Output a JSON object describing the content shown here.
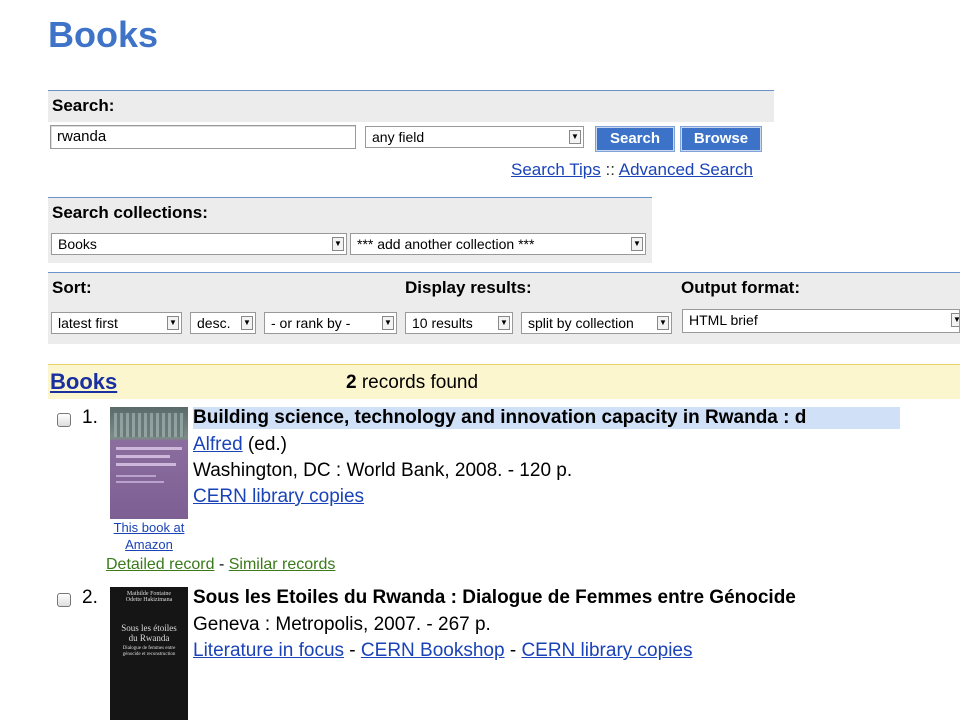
{
  "header": {
    "title": "Books"
  },
  "search": {
    "section_label": "Search:",
    "query": "rwanda",
    "field_select": "any field",
    "search_button": "Search",
    "browse_button": "Browse",
    "tips_link": "Search Tips",
    "tips_sep": "::",
    "advanced_link": "Advanced Search"
  },
  "collections": {
    "section_label": "Search collections:",
    "selected": "Books",
    "add_another": "*** add another collection ***"
  },
  "options": {
    "sort_label": "Sort:",
    "display_label": "Display results:",
    "output_label": "Output format:",
    "sort_by": "latest first",
    "order": "desc.",
    "rank_by": "- or rank by -",
    "per_page": "10 results",
    "split": "split by collection",
    "output_format": "HTML brief"
  },
  "results": {
    "collection": "Books",
    "count": "2",
    "found_text": "records found",
    "records": [
      {
        "number": "1.",
        "title": "Building science, technology and innovation capacity in Rwanda : d",
        "author_link": "Alfred",
        "author_suffix": " (ed.)",
        "publication": "Washington, DC : World Bank, 2008. - 120 p.",
        "links": [
          "CERN library copies"
        ],
        "amazon_link": "This book at Amazon",
        "detailed_link": "Detailed record",
        "similar_link": "Similar records",
        "dash": " - "
      },
      {
        "number": "2.",
        "title": "Sous les Etoiles du Rwanda : Dialogue de Femmes entre Génocide",
        "publication": "Geneva : Metropolis, 2007. - 267 p.",
        "links": [
          "Literature in focus",
          "CERN Bookshop",
          "CERN library copies"
        ],
        "dash": " - ",
        "cover_text": [
          "Mathilde Fontaine",
          "Odette Hakizimana",
          "Sous les étoiles",
          "du Rwanda",
          "Dialogue de femmes entre génocide et reconstruction"
        ]
      }
    ]
  },
  "colors": {
    "accent": "#3f73c8",
    "results_bar": "#fcf6cf",
    "link": "#1a43b8",
    "green_link": "#3a7a1a"
  }
}
